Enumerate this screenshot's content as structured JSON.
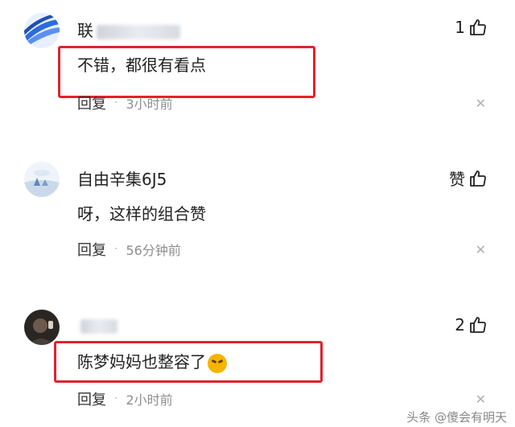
{
  "comments": [
    {
      "username": "联",
      "like_count": "1",
      "text": "不错，都很有看点",
      "reply_label": "回复",
      "separator": "·",
      "time": "3小时前"
    },
    {
      "username": "自由辛集6J5",
      "like_label": "赞",
      "text": "呀，这样的组合赞",
      "reply_label": "回复",
      "separator": "·",
      "time": "56分钟前"
    },
    {
      "username": "",
      "like_count": "2",
      "text": "陈梦妈妈也整容了",
      "reply_label": "回复",
      "separator": "·",
      "time": "2小时前"
    }
  ],
  "icons": {
    "like": "thumbs-up-icon",
    "close": "close-icon",
    "emoji": "laughing-crying-emoji-icon"
  },
  "colors": {
    "highlight_border": "#e0232e",
    "meta_text": "#8e8e8e"
  },
  "watermark": "头条 @傻会有明天"
}
